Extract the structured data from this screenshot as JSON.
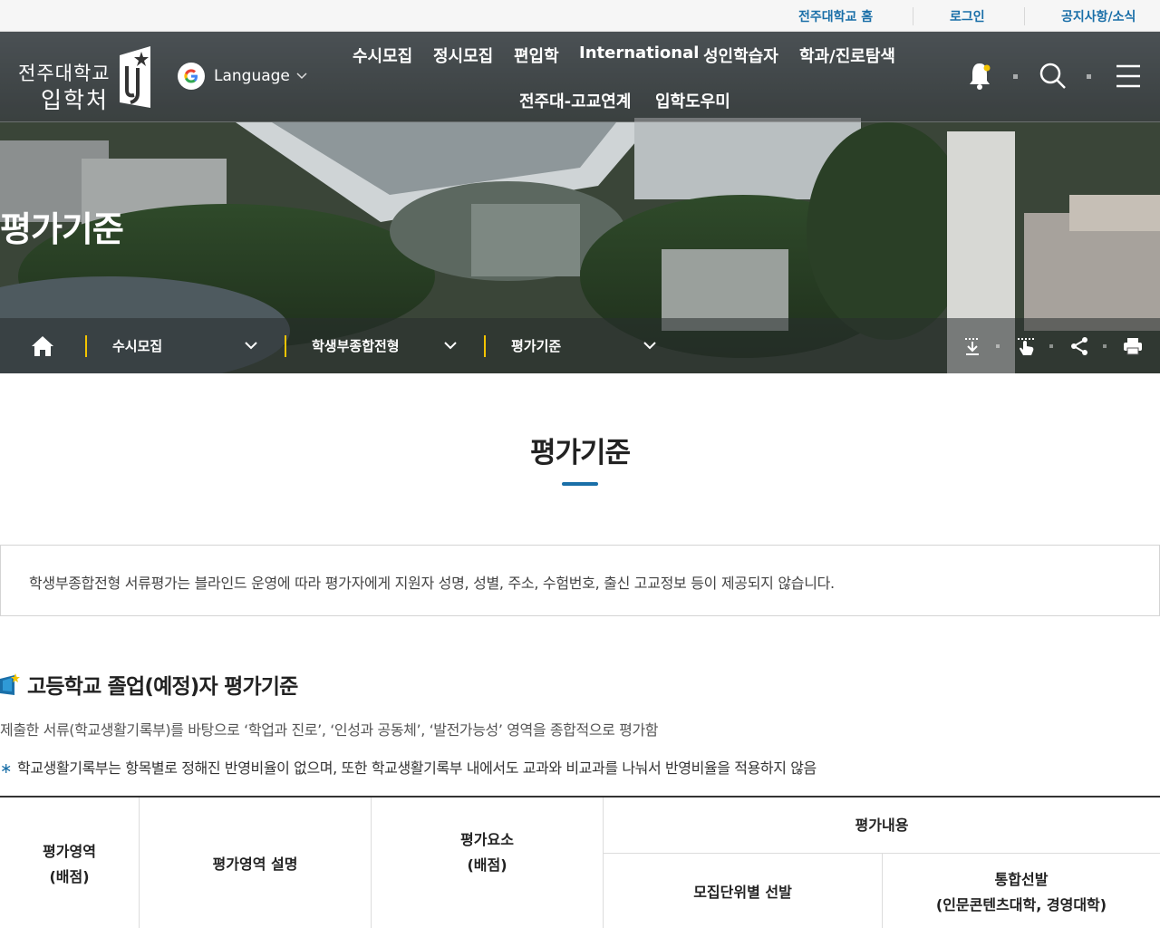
{
  "util_links": [
    "전주대학교 홈",
    "로그인",
    "공지사항/소식"
  ],
  "logo": {
    "line1": "전주대학교",
    "line2": "입학처"
  },
  "language_label": "Language",
  "nav": {
    "row1": [
      "수시모집",
      "정시모집",
      "편입학",
      "International",
      "성인학습자",
      "학과/진로탐색"
    ],
    "row2": [
      "전주대-고교연계",
      "입학도우미"
    ]
  },
  "header_icons": [
    "bell-icon",
    "search-icon",
    "menu-icon"
  ],
  "hero_title": "평가기준",
  "breadcrumb": [
    "수시모집",
    "학생부종합전형",
    "평가기준"
  ],
  "tools": [
    "download-icon",
    "touch-icon",
    "share-icon",
    "print-icon"
  ],
  "main_title": "평가기준",
  "notice": "학생부종합전형 서류평가는 블라인드 운영에 따라 평가자에게 지원자 성명, 성별, 주소, 수험번호, 출신 고교정보 등이 제공되지 않습니다.",
  "section": {
    "heading": "고등학교 졸업(예정)자 평가기준",
    "description": "제출한 서류(학교생활기록부)를 바탕으로 ‘학업과 진로’, ‘인성과 공동체’, ‘발전가능성’ 영역을 종합적으로 평가함",
    "note": "학교생활기록부는 항목별로 정해진 반영비율이 없으며, 또한 학교생활기록부 내에서도 교과와 비교과를 나눠서 반영비율을 적용하지 않음"
  },
  "table": {
    "col1_line1": "평가영역",
    "col1_line2": "(배점)",
    "col2": "평가영역 설명",
    "col3_line1": "평가요소",
    "col3_line2": "(배점)",
    "group": "평가내용",
    "sub1": "모집단위별 선발",
    "sub2_line1": "통합선발",
    "sub2_line2": "(인문콘텐츠대학, 경영대학)"
  },
  "colors": {
    "accent": "#1a6fa8",
    "crumb_divider": "#f3c400"
  }
}
